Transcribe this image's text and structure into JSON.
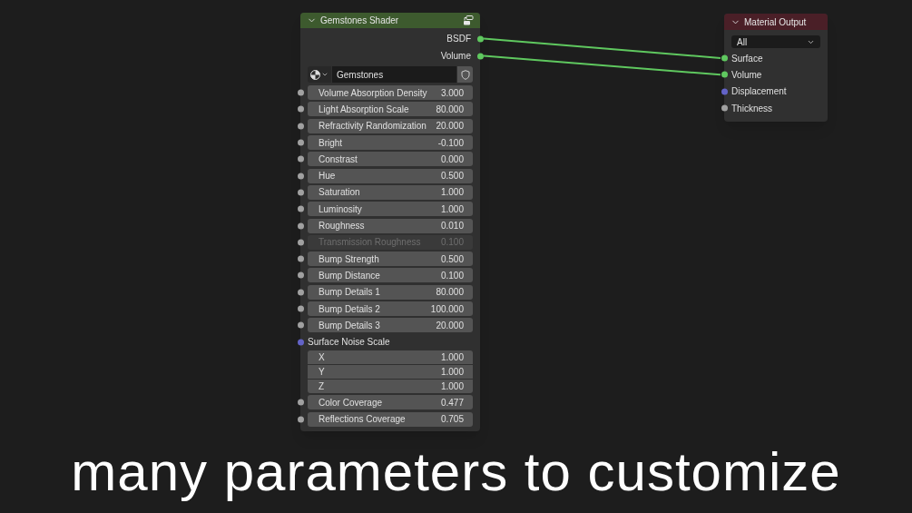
{
  "shader_node": {
    "title": "Gemstones Shader",
    "outputs": [
      {
        "label": "BSDF",
        "color": "#5fc85f",
        "connected": true
      },
      {
        "label": "Volume",
        "color": "#5fc85f",
        "connected": true
      }
    ],
    "material": {
      "name": "Gemstones"
    },
    "inputs": [
      {
        "kind": "value",
        "label": "Volume Absorption Density",
        "value": "3.000",
        "disabled": false,
        "color": "#a1a1a1"
      },
      {
        "kind": "value",
        "label": "Light Absorption Scale",
        "value": "80.000",
        "disabled": false,
        "color": "#a1a1a1"
      },
      {
        "kind": "value",
        "label": "Refractivity Randomization",
        "value": "20.000",
        "disabled": false,
        "color": "#a1a1a1"
      },
      {
        "kind": "value",
        "label": "Bright",
        "value": "-0.100",
        "disabled": false,
        "color": "#a1a1a1"
      },
      {
        "kind": "value",
        "label": "Constrast",
        "value": "0.000",
        "disabled": false,
        "color": "#a1a1a1"
      },
      {
        "kind": "value",
        "label": "Hue",
        "value": "0.500",
        "disabled": false,
        "color": "#a1a1a1"
      },
      {
        "kind": "value",
        "label": "Saturation",
        "value": "1.000",
        "disabled": false,
        "color": "#a1a1a1"
      },
      {
        "kind": "value",
        "label": "Luminosity",
        "value": "1.000",
        "disabled": false,
        "color": "#a1a1a1"
      },
      {
        "kind": "value",
        "label": "Roughness",
        "value": "0.010",
        "disabled": false,
        "color": "#a1a1a1"
      },
      {
        "kind": "value",
        "label": "Transmission Roughness",
        "value": "0.100",
        "disabled": true,
        "color": "#a1a1a1"
      },
      {
        "kind": "value",
        "label": "Bump Strength",
        "value": "0.500",
        "disabled": false,
        "color": "#a1a1a1"
      },
      {
        "kind": "value",
        "label": "Bump Distance",
        "value": "0.100",
        "disabled": false,
        "color": "#a1a1a1"
      },
      {
        "kind": "value",
        "label": "Bump Details 1",
        "value": "80.000",
        "disabled": false,
        "color": "#a1a1a1"
      },
      {
        "kind": "value",
        "label": "Bump Details 2",
        "value": "100.000",
        "disabled": false,
        "color": "#a1a1a1"
      },
      {
        "kind": "value",
        "label": "Bump Details 3",
        "value": "20.000",
        "disabled": false,
        "color": "#a1a1a1"
      },
      {
        "kind": "vector",
        "label": "Surface Noise Scale",
        "color": "#6363c7",
        "components": [
          {
            "label": "X",
            "value": "1.000"
          },
          {
            "label": "Y",
            "value": "1.000"
          },
          {
            "label": "Z",
            "value": "1.000"
          }
        ]
      },
      {
        "kind": "value",
        "label": "Color Coverage",
        "value": "0.477",
        "disabled": false,
        "color": "#a1a1a1"
      },
      {
        "kind": "value",
        "label": "Reflections Coverage",
        "value": "0.705",
        "disabled": false,
        "color": "#a1a1a1"
      }
    ]
  },
  "output_node": {
    "title": "Material Output",
    "target": "All",
    "inputs": [
      {
        "label": "Surface",
        "color": "#5fc85f"
      },
      {
        "label": "Volume",
        "color": "#5fc85f"
      },
      {
        "label": "Displacement",
        "color": "#6363c7"
      },
      {
        "label": "Thickness",
        "color": "#a1a1a1"
      }
    ]
  },
  "caption": "many parameters to customize"
}
